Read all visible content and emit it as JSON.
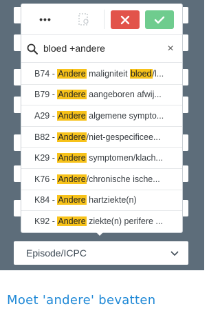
{
  "toolbar": {
    "more_label": "•••",
    "cancel_color": "#e2534a",
    "confirm_color": "#6fcc8e"
  },
  "search": {
    "value": "bloed +andere",
    "clear_label": "×"
  },
  "results": [
    {
      "code": "B74 - ",
      "parts": [
        {
          "t": "Andere",
          "h": true
        },
        {
          "t": " maligniteit ",
          "h": false
        },
        {
          "t": "bloed",
          "h": true
        },
        {
          "t": "/l...",
          "h": false
        }
      ]
    },
    {
      "code": "B79 - ",
      "parts": [
        {
          "t": "Andere",
          "h": true
        },
        {
          "t": " aangeboren afwij...",
          "h": false
        }
      ]
    },
    {
      "code": "A29 - ",
      "parts": [
        {
          "t": "Andere",
          "h": true
        },
        {
          "t": " algemene sympto...",
          "h": false
        }
      ]
    },
    {
      "code": "B82 - ",
      "parts": [
        {
          "t": "Andere",
          "h": true
        },
        {
          "t": "/niet-gespecificee...",
          "h": false
        }
      ]
    },
    {
      "code": "K29 - ",
      "parts": [
        {
          "t": "Andere",
          "h": true
        },
        {
          "t": " symptomen/klach...",
          "h": false
        }
      ]
    },
    {
      "code": "K76 - ",
      "parts": [
        {
          "t": "Andere",
          "h": true
        },
        {
          "t": "/chronische ische...",
          "h": false
        }
      ]
    },
    {
      "code": "K84 - ",
      "parts": [
        {
          "t": "Andere",
          "h": true
        },
        {
          "t": " hartziekte(n)",
          "h": false
        }
      ]
    },
    {
      "code": "K92 - ",
      "parts": [
        {
          "t": "Andere",
          "h": true
        },
        {
          "t": " ziekte(n) perifere ...",
          "h": false
        }
      ]
    }
  ],
  "bottom_select": {
    "label": "Episode/ICPC"
  },
  "caption": "Moet 'andere' bevatten",
  "highlight_color": "#f7c21a"
}
